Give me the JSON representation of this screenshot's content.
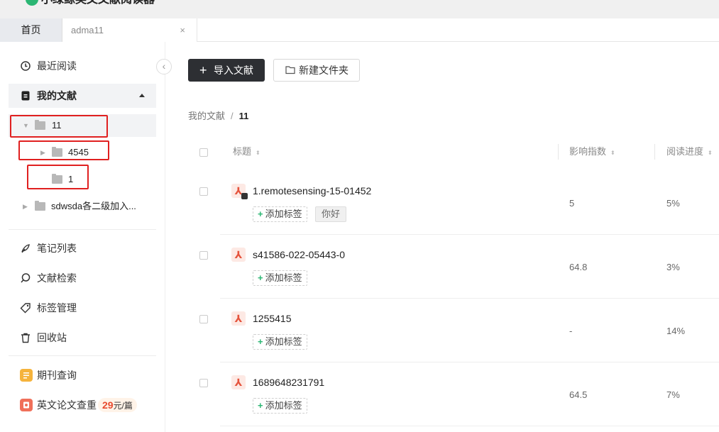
{
  "app": {
    "title": "小绿鲸英文文献阅读器"
  },
  "tabs": {
    "home": "首页",
    "doc": "adma11",
    "close": "×"
  },
  "sidebar": {
    "collapse_glyph": "‹",
    "recent": "最近阅读",
    "my_docs": "我的文献",
    "tree": [
      {
        "label": "11",
        "arrow": "▼"
      },
      {
        "label": "4545",
        "arrow": "▶"
      },
      {
        "label": "1",
        "arrow": ""
      },
      {
        "label": "sdwsda各二级加入...",
        "arrow": "▶"
      }
    ],
    "notes": "笔记列表",
    "search": "文献检索",
    "tags": "标签管理",
    "trash": "回收站",
    "journal": "期刊查询",
    "plagiarism": "英文论文查重",
    "price_num": "29",
    "price_unit": "元/篇"
  },
  "toolbar": {
    "import_plus": "+",
    "import_label": "导入文献",
    "new_folder_label": "新建文件夹"
  },
  "breadcrumb": {
    "root": "我的文献",
    "sep": "/",
    "current": "11"
  },
  "table": {
    "headers": {
      "title": "标题",
      "impact": "影响指数",
      "progress": "阅读进度"
    },
    "sort_glyph": "⬍",
    "add_tag_plus": "+",
    "add_tag_label": "添加标签",
    "rows": [
      {
        "title": "1.remotesensing-15-01452",
        "impact": "5",
        "progress": "5%",
        "tag": "你好"
      },
      {
        "title": "s41586-022-05443-0",
        "impact": "64.8",
        "progress": "3%"
      },
      {
        "title": "1255415",
        "impact": "-",
        "progress": "14%"
      },
      {
        "title": "1689648231791",
        "impact": "64.5",
        "progress": "7%"
      }
    ]
  },
  "colors": {
    "accent_green": "#2bb673",
    "pdf_red": "#e5533c",
    "highlight_red": "#e02020"
  }
}
